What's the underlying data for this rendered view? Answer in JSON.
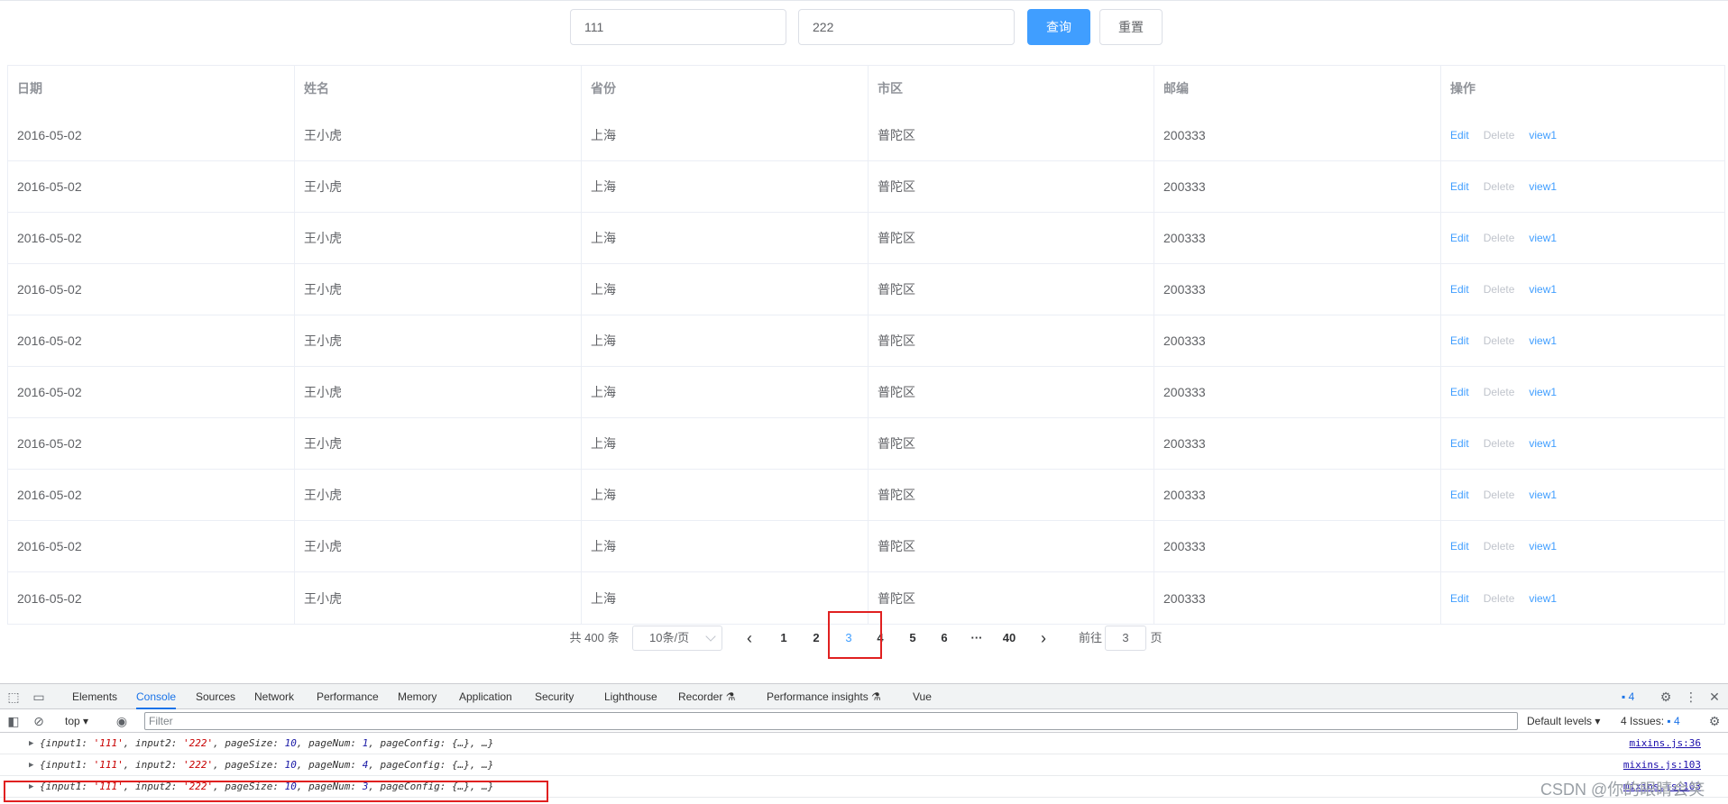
{
  "search": {
    "input1_value": "111",
    "input2_value": "222",
    "query_label": "查询",
    "reset_label": "重置"
  },
  "table": {
    "columns": [
      "日期",
      "姓名",
      "省份",
      "市区",
      "邮编",
      "操作"
    ],
    "rows": [
      {
        "date": "2016-05-02",
        "name": "王小虎",
        "province": "上海",
        "city": "普陀区",
        "zip": "200333"
      },
      {
        "date": "2016-05-02",
        "name": "王小虎",
        "province": "上海",
        "city": "普陀区",
        "zip": "200333"
      },
      {
        "date": "2016-05-02",
        "name": "王小虎",
        "province": "上海",
        "city": "普陀区",
        "zip": "200333"
      },
      {
        "date": "2016-05-02",
        "name": "王小虎",
        "province": "上海",
        "city": "普陀区",
        "zip": "200333"
      },
      {
        "date": "2016-05-02",
        "name": "王小虎",
        "province": "上海",
        "city": "普陀区",
        "zip": "200333"
      },
      {
        "date": "2016-05-02",
        "name": "王小虎",
        "province": "上海",
        "city": "普陀区",
        "zip": "200333"
      },
      {
        "date": "2016-05-02",
        "name": "王小虎",
        "province": "上海",
        "city": "普陀区",
        "zip": "200333"
      },
      {
        "date": "2016-05-02",
        "name": "王小虎",
        "province": "上海",
        "city": "普陀区",
        "zip": "200333"
      },
      {
        "date": "2016-05-02",
        "name": "王小虎",
        "province": "上海",
        "city": "普陀区",
        "zip": "200333"
      },
      {
        "date": "2016-05-02",
        "name": "王小虎",
        "province": "上海",
        "city": "普陀区",
        "zip": "200333"
      }
    ],
    "actions": {
      "edit": "Edit",
      "delete": "Delete",
      "view": "view1"
    }
  },
  "pagination": {
    "total_text": "共 400 条",
    "page_size_text": "10条/页",
    "prev_icon": "chevron-left-icon",
    "next_icon": "chevron-right-icon",
    "pages": [
      "1",
      "2",
      "3",
      "4",
      "5",
      "6"
    ],
    "ellipsis": "···",
    "last_page": "40",
    "current_page": "3",
    "goto_label": "前往",
    "goto_value": "3",
    "goto_suffix": "页"
  },
  "devtools": {
    "tabs": [
      "Elements",
      "Console",
      "Sources",
      "Network",
      "Performance",
      "Memory",
      "Application",
      "Security",
      "Lighthouse",
      "Recorder",
      "Performance insights",
      "Vue"
    ],
    "active_tab": "Console",
    "issues_badge": "4",
    "context": "top",
    "filter_placeholder": "Filter",
    "levels": "Default levels",
    "issues_text": "4 Issues:",
    "issues_count": "4",
    "logs": [
      {
        "pageNum": "1",
        "src": "mixins.js:36"
      },
      {
        "pageNum": "4",
        "src": "mixins.js:103"
      },
      {
        "pageNum": "3",
        "src": "mixins.js:103"
      }
    ],
    "log_prefix": "{input1: ",
    "log_input1": "'111'",
    "log_mid1": ", input2: ",
    "log_input2": "'222'",
    "log_mid2": ", pageSize: ",
    "log_pagesize": "10",
    "log_mid3": ", pageNum: ",
    "log_suffix": ", pageConfig: {…}, …}"
  },
  "watermark": "CSDN @你的眼睛会笑",
  "colors": {
    "primary": "#409eff",
    "highlight": "#e02020",
    "devtools_active": "#1a73e8"
  }
}
